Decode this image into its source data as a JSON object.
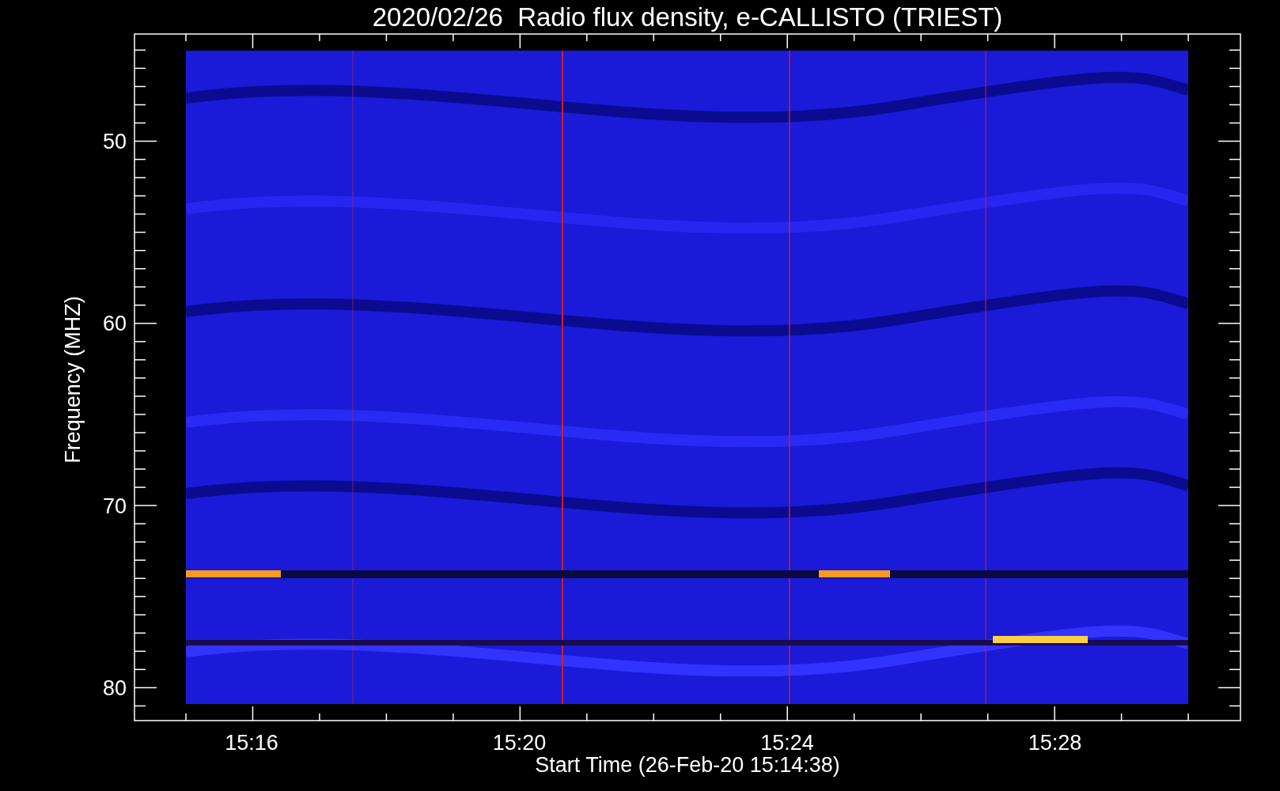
{
  "title": "2020/02/26  Radio flux density, e-CALLISTO (TRIEST)",
  "x_axis": {
    "label": "Start Time (26-Feb-20 15:14:38)",
    "ticks": [
      "15:16",
      "15:20",
      "15:24",
      "15:28"
    ]
  },
  "y_axis": {
    "label": "Frequency (MHZ)",
    "ticks": [
      "50",
      "60",
      "70",
      "80"
    ]
  }
}
